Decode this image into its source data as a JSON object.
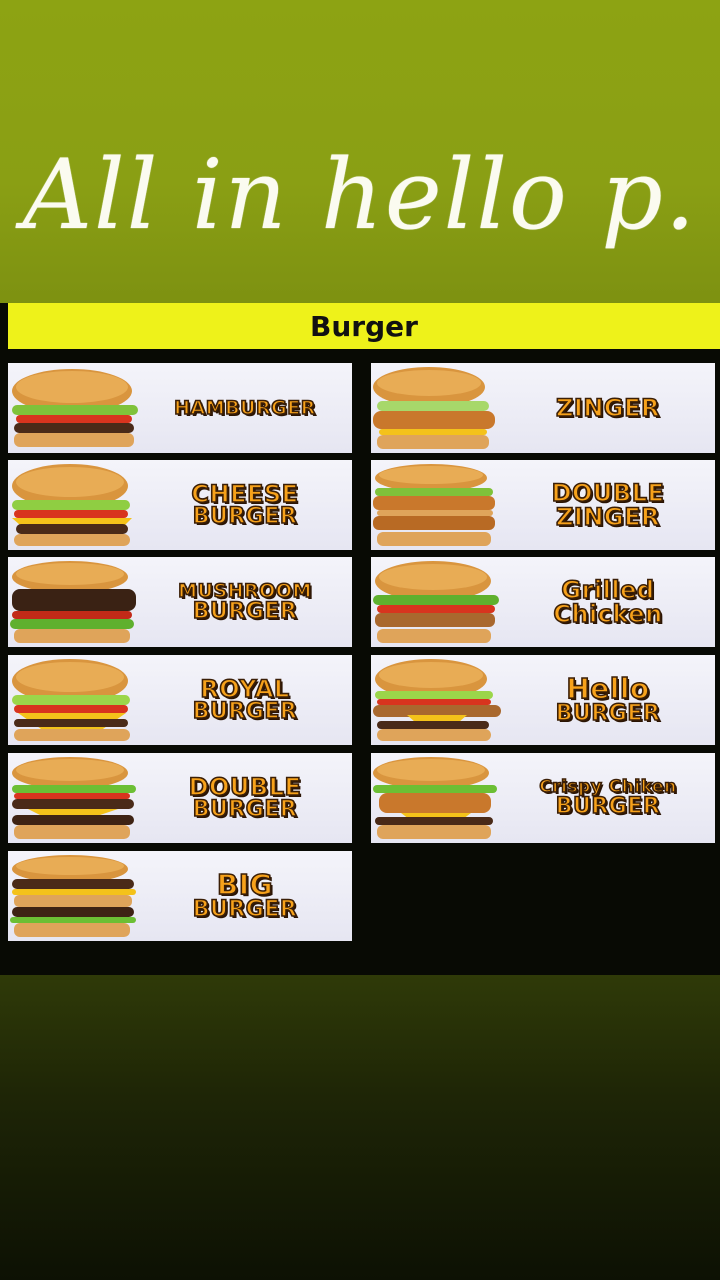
{
  "story": {
    "title": "All in hello p."
  },
  "menu": {
    "header": "Burger",
    "left": [
      {
        "line1": "HAMBURGER",
        "line2": ""
      },
      {
        "line1": "CHEESE",
        "line2": "BURGER"
      },
      {
        "line1": "MUSHROOM",
        "line2": "BURGER"
      },
      {
        "line1": "ROYAL",
        "line2": "BURGER"
      },
      {
        "line1": "DOUBLE",
        "line2": "BURGER"
      },
      {
        "line1": "BIG",
        "line2": "BURGER"
      }
    ],
    "right": [
      {
        "line1": "ZINGER",
        "line2": ""
      },
      {
        "line1": "DOUBLE",
        "line2": "ZINGER"
      },
      {
        "line1": "Grilled",
        "line2": "Chicken"
      },
      {
        "line1": "Hello",
        "line2": "BURGER"
      },
      {
        "line1": "Crispy Chiken",
        "line2": "BURGER"
      }
    ]
  },
  "colors": {
    "header_bg": "#eef21a",
    "label_fill": "#f7a21b",
    "label_outline": "#3a1e06",
    "background_top": "#8da313",
    "board_bg": "#080a04"
  }
}
